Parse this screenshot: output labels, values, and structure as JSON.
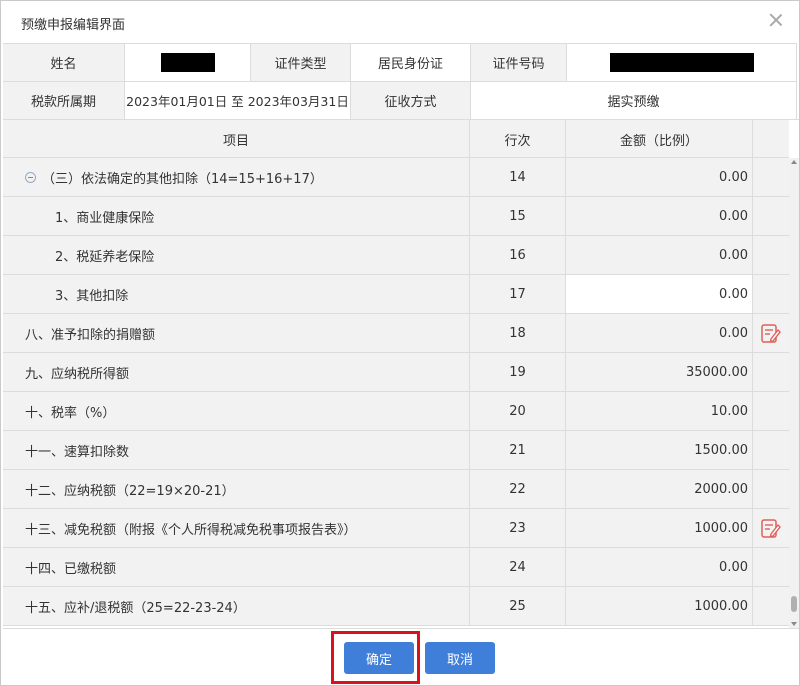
{
  "dialog": {
    "title": "预缴申报编辑界面"
  },
  "info": {
    "name_label": "姓名",
    "id_type_label": "证件类型",
    "id_type_value": "居民身份证",
    "id_no_label": "证件号码",
    "period_label": "税款所属期",
    "period_value": "2023年01月01日 至 2023年03月31日",
    "method_label": "征收方式",
    "method_value": "据实预缴"
  },
  "table": {
    "headers": {
      "item": "项目",
      "line": "行次",
      "amount": "金额（比例）"
    },
    "rows": [
      {
        "item": "（三）依法确定的其他扣除（14=15+16+17）",
        "line": "14",
        "amount": "0.00"
      },
      {
        "item": "1、商业健康保险",
        "line": "15",
        "amount": "0.00"
      },
      {
        "item": "2、税延养老保险",
        "line": "16",
        "amount": "0.00"
      },
      {
        "item": "3、其他扣除",
        "line": "17",
        "amount": "0.00"
      },
      {
        "item": "八、准予扣除的捐赠额",
        "line": "18",
        "amount": "0.00"
      },
      {
        "item": "九、应纳税所得额",
        "line": "19",
        "amount": "35000.00"
      },
      {
        "item": "十、税率（%）",
        "line": "20",
        "amount": "10.00"
      },
      {
        "item": "十一、速算扣除数",
        "line": "21",
        "amount": "1500.00"
      },
      {
        "item": "十二、应纳税额（22=19×20-21）",
        "line": "22",
        "amount": "2000.00"
      },
      {
        "item": "十三、减免税额（附报《个人所得税减免税事项报告表》）",
        "line": "23",
        "amount": "1000.00"
      },
      {
        "item": "十四、已缴税额",
        "line": "24",
        "amount": "0.00"
      },
      {
        "item": "十五、应补/退税额（25=22-23-24）",
        "line": "25",
        "amount": "1000.00"
      }
    ]
  },
  "footer": {
    "confirm_label": "确定",
    "cancel_label": "取消"
  },
  "colors": {
    "primary": "#3f7fd9",
    "highlight": "#d9121b",
    "edit_icon": "#e0605a"
  },
  "icons": {
    "close": "close-icon",
    "collapse": "collapse-icon",
    "edit": "edit-icon"
  }
}
